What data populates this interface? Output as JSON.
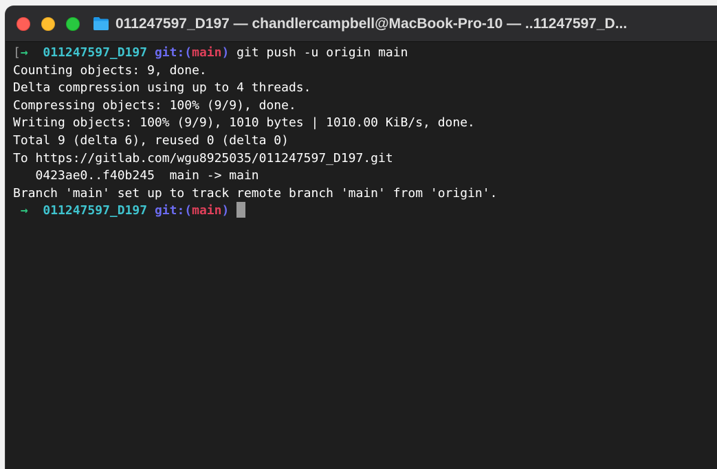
{
  "window": {
    "title": "011247597_D197 — chandlercampbell@MacBook-Pro-10 — ..11247597_D..."
  },
  "traffic_lights": {
    "close_color": "#ff5f57",
    "minimize_color": "#febc2e",
    "maximize_color": "#28c840"
  },
  "icons": {
    "title_icon": "folder-icon"
  },
  "terminal": {
    "prompt1": {
      "bracket": "[",
      "arrow": "→",
      "dir": "011247597_D197",
      "git_label": "git:(",
      "branch": "main",
      "git_close": ")",
      "command": "git push -u origin main"
    },
    "output": [
      "Counting objects: 9, done.",
      "Delta compression using up to 4 threads.",
      "Compressing objects: 100% (9/9), done.",
      "Writing objects: 100% (9/9), 1010 bytes | 1010.00 KiB/s, done.",
      "Total 9 (delta 6), reused 0 (delta 0)",
      "To https://gitlab.com/wgu8925035/011247597_D197.git",
      "   0423ae0..f40b245  main -> main",
      "Branch 'main' set up to track remote branch 'main' from 'origin'."
    ],
    "prompt2": {
      "arrow": "→",
      "dir": "011247597_D197",
      "git_label": "git:(",
      "branch": "main",
      "git_close": ")"
    }
  },
  "colors": {
    "prompt_arrow": "#2ec27e",
    "directory": "#3fc4cf",
    "git_label": "#6b6bf0",
    "branch": "#e0405a",
    "background": "#1e1e1e",
    "text": "#ffffff"
  }
}
